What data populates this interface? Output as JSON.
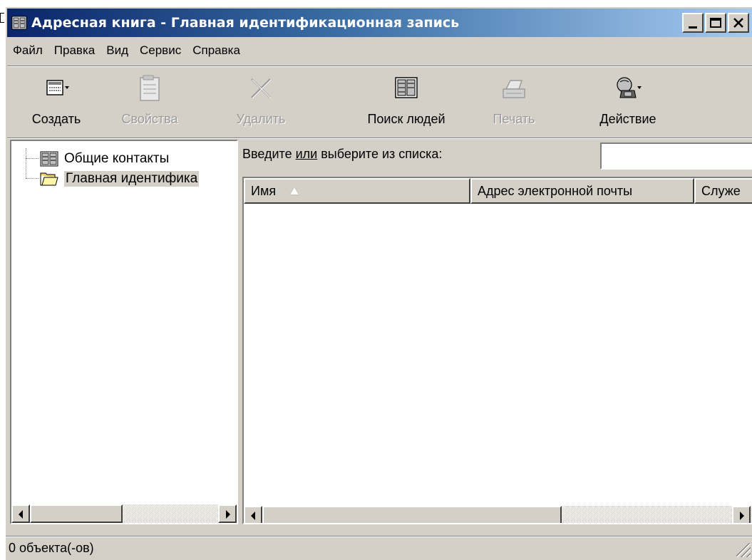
{
  "window": {
    "title": "Адресная книга - Главная идентификационная запись",
    "title_buttons": {
      "minimize": "_",
      "maximize": "□",
      "close": "X"
    }
  },
  "menu": {
    "items": [
      {
        "label": "Файл"
      },
      {
        "label": "Правка"
      },
      {
        "label": "Вид"
      },
      {
        "label": "Сервис"
      },
      {
        "label": "Справка"
      }
    ]
  },
  "toolbar": {
    "buttons": [
      {
        "label": "Создать",
        "icon": "new-contact-icon",
        "enabled": true,
        "dropdown": true
      },
      {
        "label": "Свойства",
        "icon": "properties-icon",
        "enabled": false
      },
      {
        "label": "Удалить",
        "icon": "delete-icon",
        "enabled": false
      },
      {
        "label": "Поиск людей",
        "icon": "find-people-icon",
        "enabled": true
      },
      {
        "label": "Печать",
        "icon": "print-icon",
        "enabled": false
      },
      {
        "label": "Действие",
        "icon": "action-phone-icon",
        "enabled": true,
        "dropdown": true
      }
    ]
  },
  "tree": {
    "items": [
      {
        "label": "Общие контакты",
        "icon": "address-book-icon",
        "selected": false
      },
      {
        "label": "Главная идентифика",
        "icon": "folder-icon",
        "selected": true
      }
    ]
  },
  "search": {
    "label_before": "Введите ",
    "label_underlined": "или",
    "label_after": " выберите из списка:",
    "value": ""
  },
  "list": {
    "columns": [
      {
        "label": "Имя",
        "sorted": "ascending"
      },
      {
        "label": "Адрес электронной почты"
      },
      {
        "label": "Служе"
      }
    ],
    "rows": []
  },
  "status": {
    "text": "0 объекта(-ов)"
  },
  "colors": {
    "titlebar_start": "#0a246a",
    "titlebar_end": "#a6caf0",
    "face": "#d4d0c8"
  }
}
